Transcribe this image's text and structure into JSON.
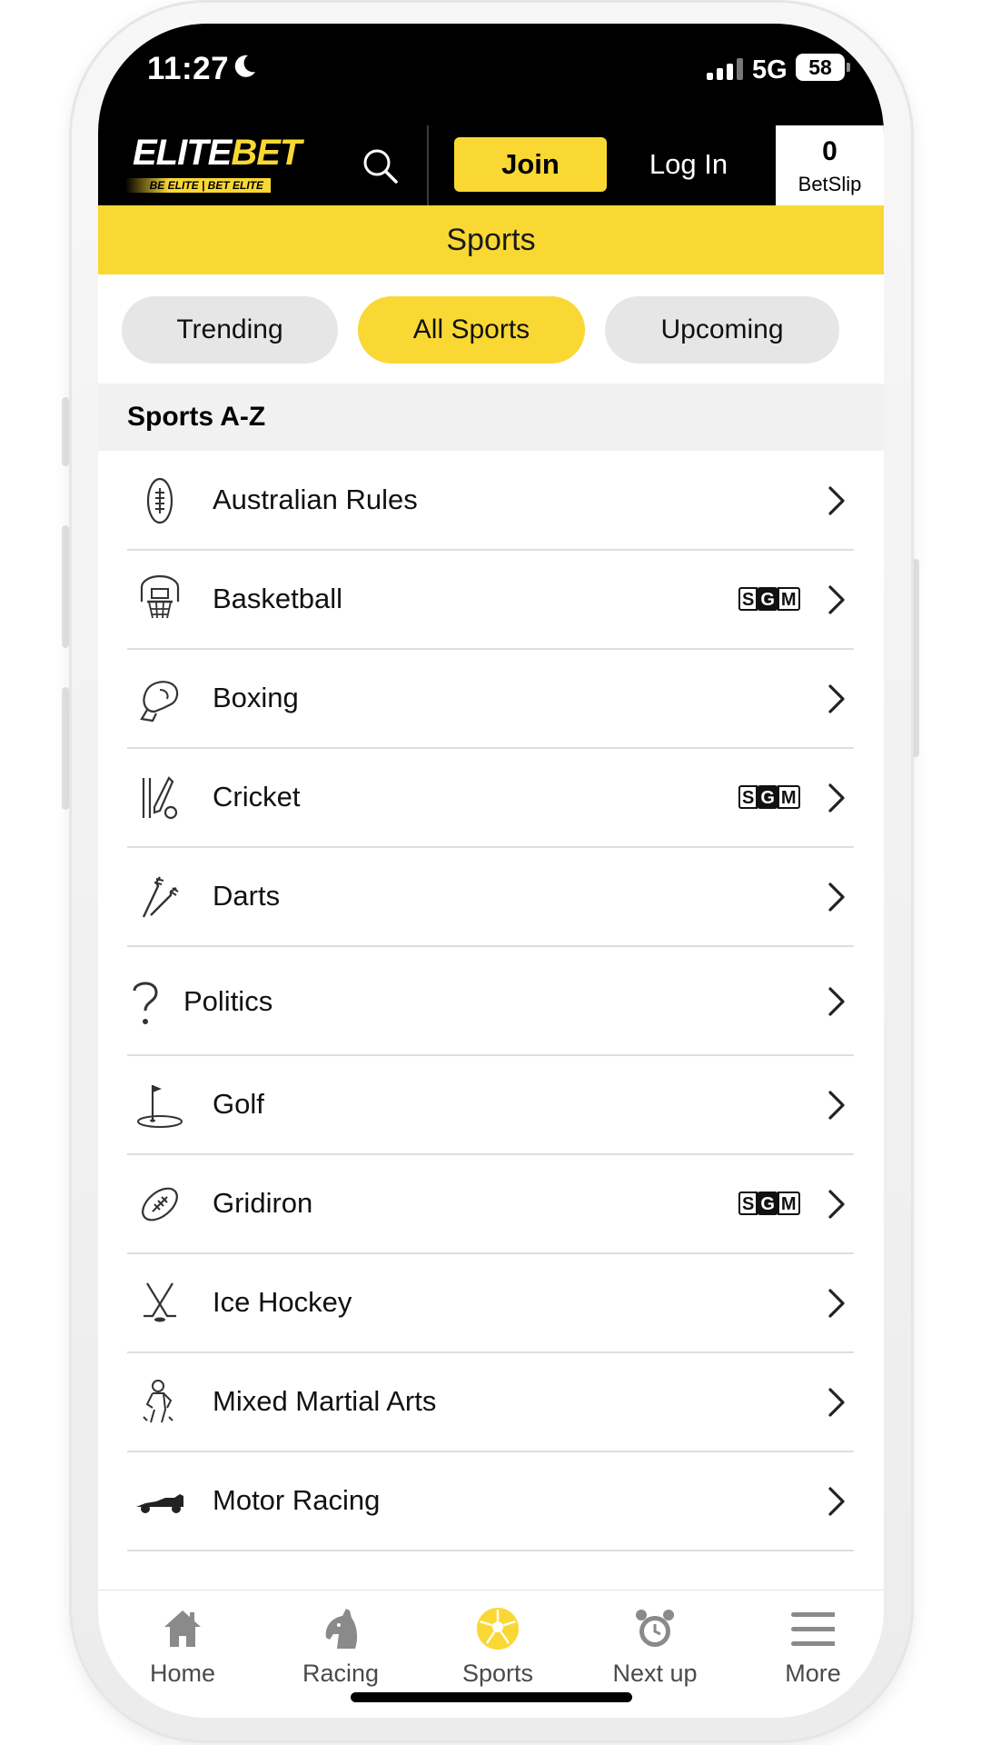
{
  "status_bar": {
    "time": "11:27",
    "network": "5G",
    "battery": "58"
  },
  "header": {
    "logo_text_a": "ELITE",
    "logo_text_b": "BET",
    "logo_tagline": "BE ELITE | BET ELITE",
    "join_label": "Join",
    "login_label": "Log In",
    "betslip_count": "0",
    "betslip_label": "BetSlip",
    "accent_color": "#fad834"
  },
  "page_title": "Sports",
  "tabs": [
    {
      "label": "Trending",
      "active": false
    },
    {
      "label": "All Sports",
      "active": true
    },
    {
      "label": "Upcoming",
      "active": false
    }
  ],
  "section_title": "Sports A-Z",
  "sports": [
    {
      "label": "Australian Rules",
      "icon": "australian-rules-ball-icon",
      "sgm": false
    },
    {
      "label": "Basketball",
      "icon": "basketball-hoop-icon",
      "sgm": true
    },
    {
      "label": "Boxing",
      "icon": "boxing-glove-icon",
      "sgm": false
    },
    {
      "label": "Cricket",
      "icon": "cricket-bat-icon",
      "sgm": true
    },
    {
      "label": "Darts",
      "icon": "darts-icon",
      "sgm": false
    },
    {
      "label": "Politics",
      "icon": "question-mark-icon",
      "sgm": false
    },
    {
      "label": "Golf",
      "icon": "golf-flag-icon",
      "sgm": false
    },
    {
      "label": "Gridiron",
      "icon": "american-football-icon",
      "sgm": true
    },
    {
      "label": "Ice Hockey",
      "icon": "hockey-sticks-icon",
      "sgm": false
    },
    {
      "label": "Mixed Martial Arts",
      "icon": "mma-fighter-icon",
      "sgm": false
    },
    {
      "label": "Motor Racing",
      "icon": "race-car-icon",
      "sgm": false
    }
  ],
  "sgm_badge": {
    "s": "S",
    "g": "G",
    "m": "M"
  },
  "bottom_nav": [
    {
      "label": "Home",
      "icon": "home-icon",
      "active": false
    },
    {
      "label": "Racing",
      "icon": "horse-head-icon",
      "active": false
    },
    {
      "label": "Sports",
      "icon": "soccer-ball-icon",
      "active": true
    },
    {
      "label": "Next up",
      "icon": "alarm-clock-icon",
      "active": false
    },
    {
      "label": "More",
      "icon": "hamburger-menu-icon",
      "active": false
    }
  ]
}
